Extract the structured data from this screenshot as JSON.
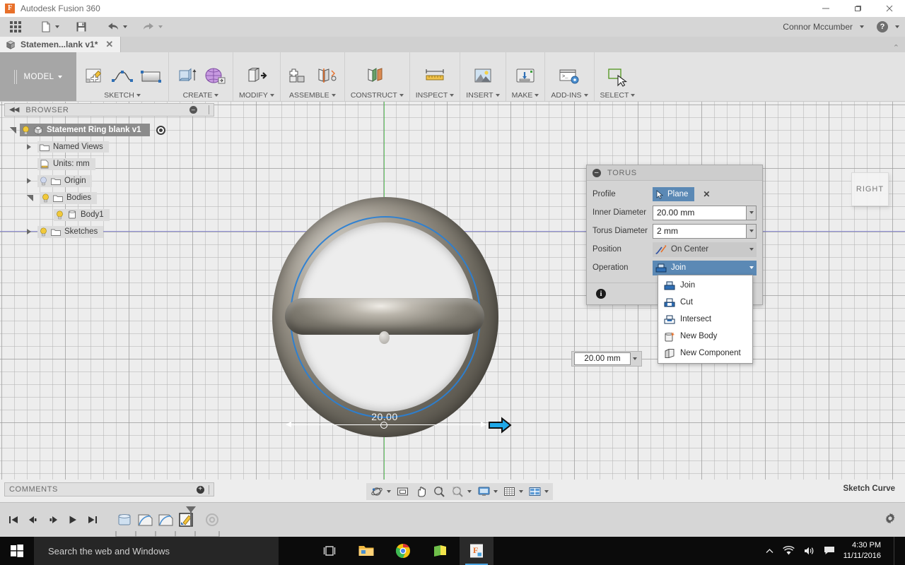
{
  "window": {
    "app_title": "Autodesk Fusion 360",
    "logo_letter": "F",
    "minimize": "—",
    "maximize": "❐",
    "close": "✕"
  },
  "quick_access": {
    "show_data_panel": "show-data-panel",
    "file_label": "file-menu",
    "save_label": "save",
    "undo_label": "undo",
    "redo_label": "redo",
    "user_name": "Connor Mccumber",
    "help_label": "?"
  },
  "tabs": {
    "document": {
      "label": "Statemen...lank v1*",
      "close": "✕"
    },
    "collapse": "⌃"
  },
  "ribbon": {
    "workspace": "MODEL",
    "groups": [
      {
        "name": "sketch",
        "label": "SKETCH"
      },
      {
        "name": "create",
        "label": "CREATE"
      },
      {
        "name": "modify",
        "label": "MODIFY"
      },
      {
        "name": "assemble",
        "label": "ASSEMBLE"
      },
      {
        "name": "construct",
        "label": "CONSTRUCT"
      },
      {
        "name": "inspect",
        "label": "INSPECT"
      },
      {
        "name": "insert",
        "label": "INSERT"
      },
      {
        "name": "make",
        "label": "MAKE"
      },
      {
        "name": "addins",
        "label": "ADD-INS"
      },
      {
        "name": "select",
        "label": "SELECT"
      }
    ]
  },
  "browser": {
    "title": "BROWSER",
    "collapse_icon": "◀◀",
    "minus_icon": "—",
    "items": [
      {
        "label": "Statement Ring blank v1",
        "level": 0
      },
      {
        "label": "Named Views",
        "level": 1
      },
      {
        "label": "Units: mm",
        "level": 1
      },
      {
        "label": "Origin",
        "level": 1
      },
      {
        "label": "Bodies",
        "level": 1
      },
      {
        "label": "Body1",
        "level": 2
      },
      {
        "label": "Sketches",
        "level": 1
      }
    ]
  },
  "viewport": {
    "viewcube_face": "RIGHT",
    "dimension_value": "20.00",
    "floating_dimension": "20.00 mm"
  },
  "torus_dialog": {
    "title": "TORUS",
    "collapse_icon": "—",
    "fields": {
      "profile": {
        "label": "Profile",
        "value": "Plane",
        "clear": "✕"
      },
      "inner_diameter": {
        "label": "Inner Diameter",
        "value": "20.00 mm"
      },
      "torus_diameter": {
        "label": "Torus Diameter",
        "value": "2 mm"
      },
      "position": {
        "label": "Position",
        "value": "On Center"
      },
      "operation": {
        "label": "Operation",
        "value": "Join"
      }
    },
    "info_icon": "i"
  },
  "operation_menu": {
    "items": [
      {
        "label": "Join",
        "icon": "join-icon"
      },
      {
        "label": "Cut",
        "icon": "cut-icon"
      },
      {
        "label": "Intersect",
        "icon": "intersect-icon"
      },
      {
        "label": "New Body",
        "icon": "new-body-icon"
      },
      {
        "label": "New Component",
        "icon": "new-component-icon"
      }
    ]
  },
  "comments": {
    "title": "COMMENTS",
    "add_icon": "+"
  },
  "navbar": {
    "items": [
      {
        "name": "orbit",
        "label": "orbit-icon"
      },
      {
        "name": "look-at",
        "label": "look-at-icon"
      },
      {
        "name": "pan",
        "label": "pan-icon"
      },
      {
        "name": "zoom",
        "label": "zoom-icon"
      },
      {
        "name": "fit",
        "label": "fit-icon"
      }
    ],
    "display_items": [
      {
        "name": "display-settings",
        "label": "display-settings-icon"
      },
      {
        "name": "grid-snaps",
        "label": "grid-snaps-icon"
      },
      {
        "name": "viewports",
        "label": "viewports-icon"
      }
    ]
  },
  "status": {
    "right_text": "Sketch Curve"
  },
  "timeline": {
    "controls": [
      "go-to-beginning",
      "step-back",
      "step-forward",
      "play",
      "go-to-end"
    ],
    "features": [
      "extrude-feature",
      "revolve-feature",
      "revolve-feature-2",
      "sketch-feature"
    ],
    "settings_icon": "gear-icon"
  },
  "taskbar": {
    "search_placeholder": "Search the web and Windows",
    "apps": [
      {
        "name": "task-view",
        "label": "task-view-icon"
      },
      {
        "name": "file-explorer",
        "label": "file-explorer-icon"
      },
      {
        "name": "google-chrome",
        "label": "chrome-icon"
      },
      {
        "name": "sticky-notes",
        "label": "sticky-notes-icon"
      },
      {
        "name": "fusion360",
        "label": "fusion-taskbar-icon"
      }
    ],
    "tray": {
      "show_hidden": "⌃",
      "network": "network-icon",
      "volume": "volume-icon",
      "action_center": "action-center-icon"
    },
    "time": "4:30 PM",
    "date": "11/11/2016"
  },
  "colors": {
    "accent_blue": "#5b89b5",
    "canvas_bg": "#ededed",
    "ribbon_bg": "#e3e3e3",
    "sketch_blue": "#2a7fd4"
  }
}
